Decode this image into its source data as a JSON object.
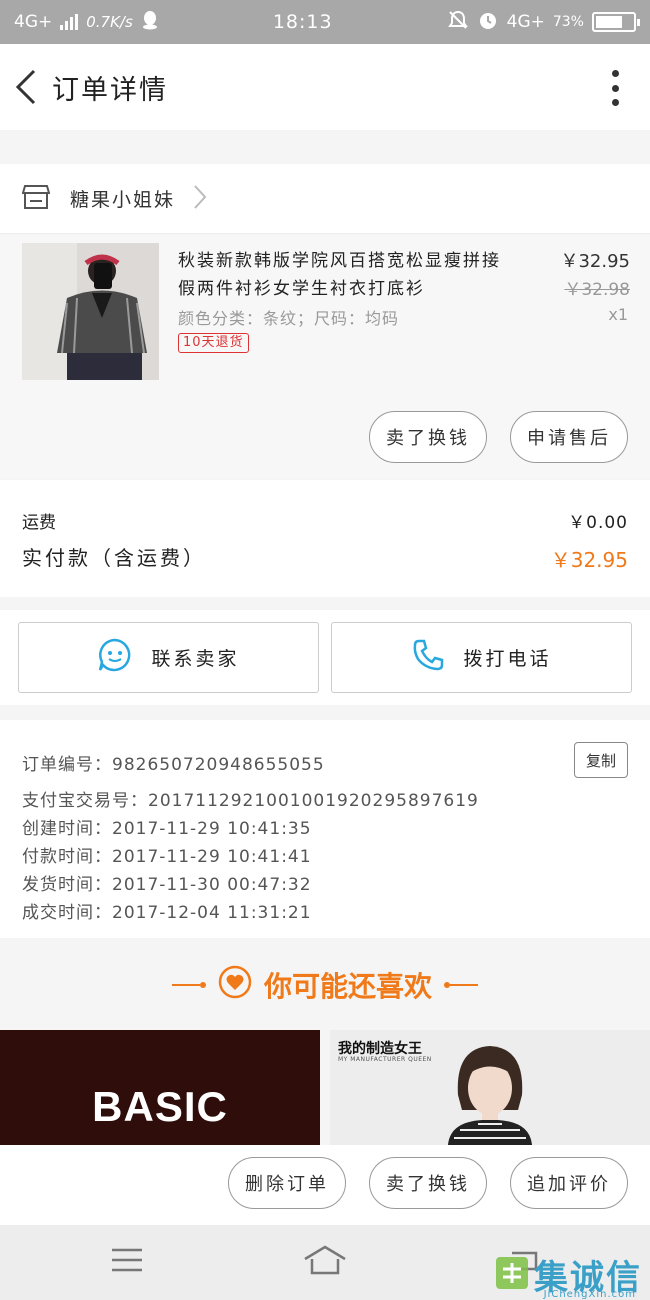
{
  "status_bar": {
    "network_left": "4G+",
    "speed": "0.7K/s",
    "time": "18:13",
    "network_right": "4G+",
    "battery": "73%",
    "battery_level": 0.73
  },
  "header": {
    "title": "订单详情"
  },
  "shop": {
    "name": "糖果小姐妹"
  },
  "product": {
    "title": "秋装新款韩版学院风百搭宽松显瘦拼接假两件衬衫女学生衬衣打底衫",
    "spec": "颜色分类：条纹；尺码：均码",
    "badge": "10天退货",
    "price": "￥32.95",
    "original_price": "￥32.98",
    "quantity": "x1",
    "btn_sell_again": "卖了换钱",
    "btn_after_sale": "申请售后"
  },
  "totals": {
    "fee_label": "运费",
    "fee_value": "￥0.00",
    "pay_label": "实付款（含运费）",
    "pay_value": "￥32.95"
  },
  "contact": {
    "seller_label": "联系卖家",
    "call_label": "拨打电话"
  },
  "order_info": {
    "order_no": "订单编号：982650720948655055",
    "alipay_no": "支付宝交易号：2017112921001001920295897619",
    "created": "创建时间：2017-11-29  10:41:35",
    "paid": "付款时间：2017-11-29  10:41:41",
    "shipped": "发货时间：2017-11-30  00:47:32",
    "completed": "成交时间：2017-12-04  11:31:21",
    "copy_label": "复制"
  },
  "recommend": {
    "title": "你可能还喜欢",
    "card1_text": "BASIC",
    "card2_title": "我的制造女王",
    "card2_sub": "MY MANUFACTURER QUEEN"
  },
  "bottom_actions": {
    "delete": "删除订单",
    "sell": "卖了换钱",
    "review": "追加评价"
  },
  "watermark": {
    "text": "集诚信",
    "url": "JiChengXin.com"
  },
  "colors": {
    "accent": "#f07a1a",
    "badge_red": "#d33333",
    "icon_blue": "#29a8e0"
  }
}
